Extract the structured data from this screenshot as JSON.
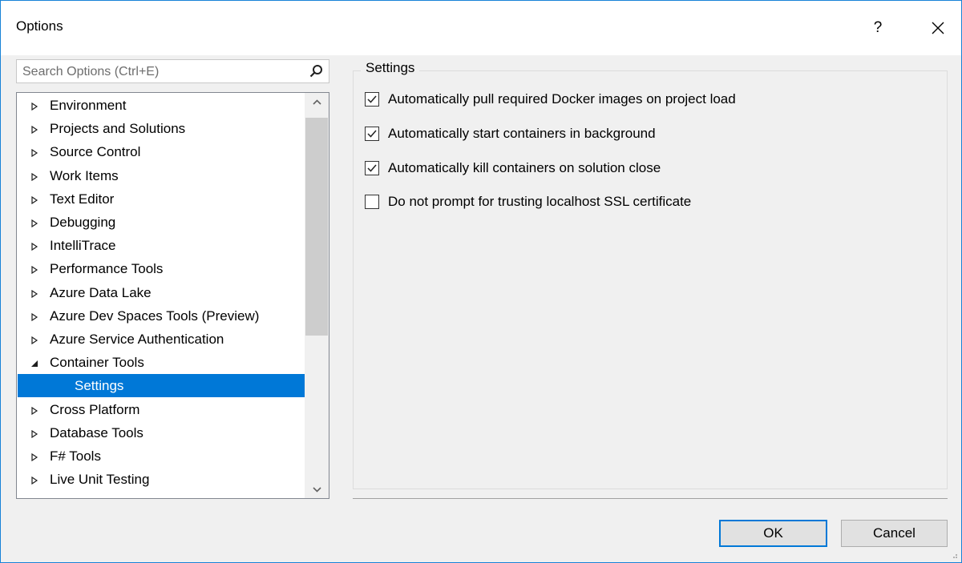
{
  "window": {
    "title": "Options",
    "help_label": "?"
  },
  "search": {
    "placeholder": "Search Options (Ctrl+E)"
  },
  "tree": {
    "items": [
      {
        "label": "Environment",
        "state": "collapsed"
      },
      {
        "label": "Projects and Solutions",
        "state": "collapsed"
      },
      {
        "label": "Source Control",
        "state": "collapsed"
      },
      {
        "label": "Work Items",
        "state": "collapsed"
      },
      {
        "label": "Text Editor",
        "state": "collapsed"
      },
      {
        "label": "Debugging",
        "state": "collapsed"
      },
      {
        "label": "IntelliTrace",
        "state": "collapsed"
      },
      {
        "label": "Performance Tools",
        "state": "collapsed"
      },
      {
        "label": "Azure Data Lake",
        "state": "collapsed"
      },
      {
        "label": "Azure Dev Spaces Tools (Preview)",
        "state": "collapsed"
      },
      {
        "label": "Azure Service Authentication",
        "state": "collapsed"
      },
      {
        "label": "Container Tools",
        "state": "expanded"
      },
      {
        "label": "Settings",
        "state": "child-selected"
      },
      {
        "label": "Cross Platform",
        "state": "collapsed"
      },
      {
        "label": "Database Tools",
        "state": "collapsed"
      },
      {
        "label": "F# Tools",
        "state": "collapsed"
      },
      {
        "label": "Live Unit Testing",
        "state": "collapsed"
      }
    ]
  },
  "settings": {
    "group_title": "Settings",
    "options": [
      {
        "label": "Automatically pull required Docker images on project load",
        "checked": true
      },
      {
        "label": "Automatically start containers in background",
        "checked": true
      },
      {
        "label": "Automatically kill containers on solution close",
        "checked": true
      },
      {
        "label": "Do not prompt for trusting localhost SSL certificate",
        "checked": false
      }
    ]
  },
  "buttons": {
    "ok": "OK",
    "cancel": "Cancel"
  },
  "colors": {
    "accent": "#0078d7",
    "window_border": "#1883d7"
  }
}
